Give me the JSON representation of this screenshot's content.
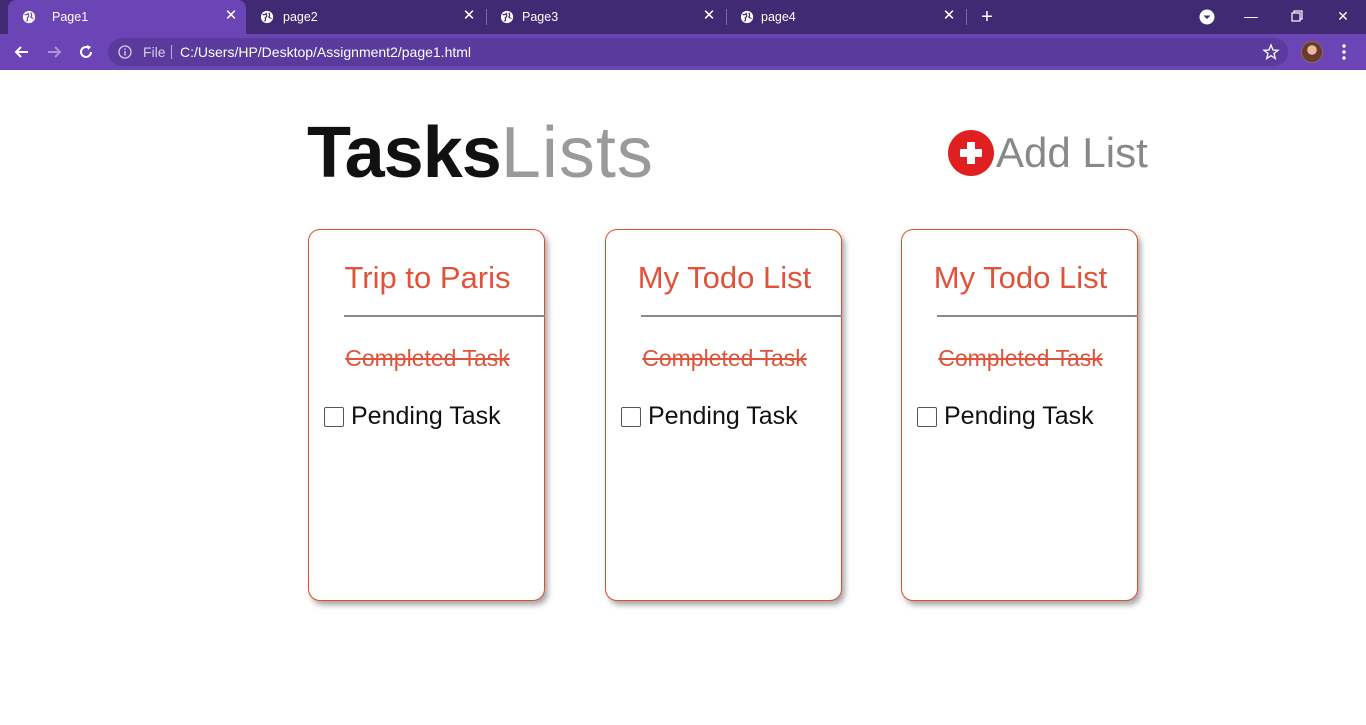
{
  "browser": {
    "tabs": [
      {
        "label": "Page1",
        "active": true
      },
      {
        "label": "page2",
        "active": false
      },
      {
        "label": "Page3",
        "active": false
      },
      {
        "label": "page4",
        "active": false
      }
    ],
    "address": {
      "scheme_label": "File",
      "url": "C:/Users/HP/Desktop/Assignment2/page1.html"
    },
    "colors": {
      "tabbar": "#3f2a73",
      "toolbar": "#6b44b6"
    }
  },
  "header": {
    "title_bold": "Tasks",
    "title_light": "Lists",
    "add_list_label": "Add List",
    "add_icon_color": "#e02020"
  },
  "lists": [
    {
      "title": "Trip to Paris",
      "completed_task": "Completed Task",
      "pending_task": "Pending Task",
      "pending_checked": false
    },
    {
      "title": "My Todo List",
      "completed_task": "Completed Task",
      "pending_task": "Pending Task",
      "pending_checked": false
    },
    {
      "title": "My Todo List",
      "completed_task": "Completed Task",
      "pending_task": "Pending Task",
      "pending_checked": false
    }
  ],
  "colors": {
    "accent": "#e0533a",
    "card_border": "#d9502e"
  }
}
